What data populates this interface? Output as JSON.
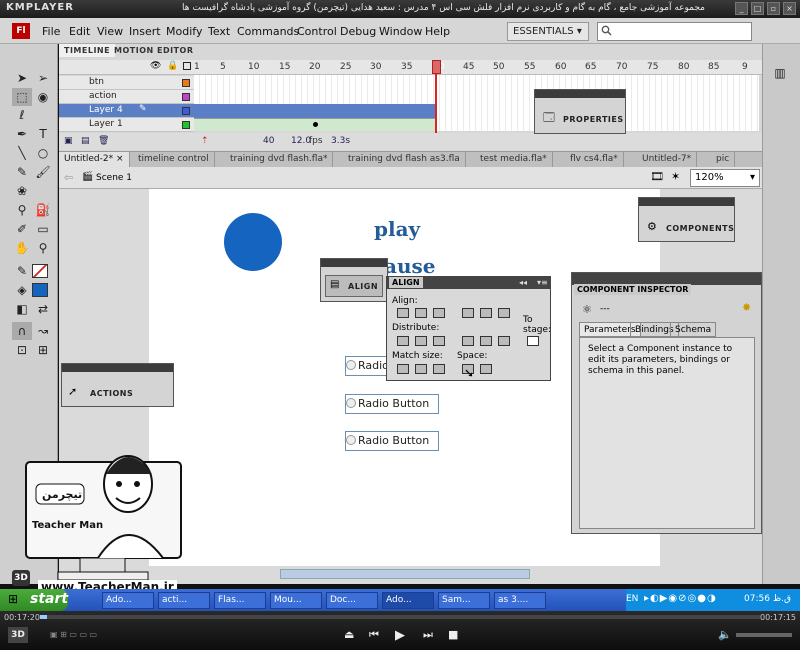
{
  "kmplayer": {
    "logo": "KMPLAYER",
    "caption": "مجموعه آموزشی جامع ، گام به گام و کاربردی نرم افزار فلش سی اس ۴ مدرس : سعید هدایی (تیچرمن) گروه آموزشی پادشاه گرافیست ها"
  },
  "menubar": {
    "logo": "Fl",
    "items": [
      "File",
      "Edit",
      "View",
      "Insert",
      "Modify",
      "Text",
      "Commands",
      "Control",
      "Debug",
      "Window",
      "Help"
    ],
    "workspace": "ESSENTIALS",
    "search_placeholder": ""
  },
  "timeline": {
    "tabs": [
      "TIMELINE",
      "MOTION EDITOR"
    ],
    "frame_numbers": [
      "1",
      "5",
      "10",
      "15",
      "20",
      "25",
      "30",
      "35",
      "40",
      "45",
      "50",
      "55",
      "60",
      "65",
      "70",
      "75",
      "80",
      "85",
      "9"
    ],
    "layers": [
      {
        "name": "btn",
        "color": "#e87a1c"
      },
      {
        "name": "action",
        "color": "#c044c8"
      },
      {
        "name": "Layer 4",
        "color": "#3a5ee0",
        "selected": true
      },
      {
        "name": "Layer 1",
        "color": "#22c22a"
      }
    ],
    "footer": {
      "current_frame": "40",
      "fps": "12.0",
      "fps_unit": "fps",
      "time": "3.3s"
    }
  },
  "properties_panel": {
    "label": "PROPERTIES"
  },
  "doc_tabs": [
    "Untitled-2*",
    "timeline control",
    "training dvd flash.fla*",
    "training dvd flash as3.fla",
    "test media.fla*",
    "flv cs4.fla*",
    "Untitled-7*",
    "pic"
  ],
  "scene": {
    "name": "Scene 1",
    "zoom": "120%"
  },
  "stage": {
    "play_text": "play",
    "pause_text": "ause",
    "radios": [
      "Radio Button",
      "Radio Button",
      "Radio Button"
    ],
    "circle_color": "#1565c0"
  },
  "components_panel": {
    "label": "COMPONENTS"
  },
  "align_panel": {
    "title": "ALIGN",
    "align_label": "Align:",
    "distribute_label": "Distribute:",
    "match_label": "Match size:",
    "space_label": "Space:",
    "to_stage_label": "To stage:"
  },
  "actions_panel": {
    "label": "ACTIONS"
  },
  "align_button": {
    "label": "ALIGN"
  },
  "component_inspector": {
    "title": "COMPONENT INSPECTOR",
    "value": "---",
    "tabs": [
      "Parameters",
      "Bindings",
      "Schema"
    ],
    "message": "Select a Component instance to edit its parameters, bindings or schema in this panel."
  },
  "watermark": {
    "site": "www.TeacherMan.ir",
    "name": "Teacher Man",
    "badge": "3D"
  },
  "taskbar": {
    "start": "start",
    "items": [
      "Ado...",
      "acti...",
      "Flas...",
      "Mou...",
      "Doc...",
      "Ado...",
      "Sam...",
      "as 3...."
    ],
    "lang": "EN",
    "clock": "07:56 ق.ظ"
  },
  "player": {
    "elapsed": "00:17:20",
    "total": "00:17:15",
    "progress": 0.01
  }
}
